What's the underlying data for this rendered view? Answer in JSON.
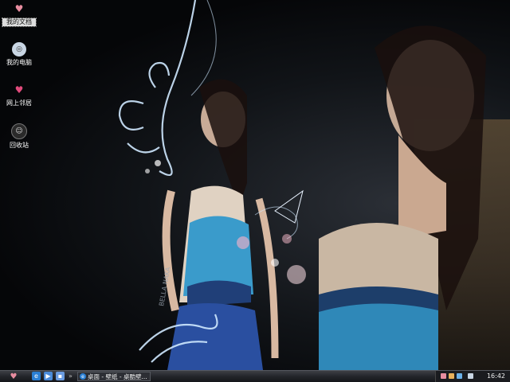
{
  "desktop": {
    "icons": [
      {
        "label": "我的文档",
        "icon": "my-documents-icon",
        "selected": true
      },
      {
        "label": "我的电脑",
        "icon": "my-computer-icon",
        "selected": false
      },
      {
        "label": "网上邻居",
        "icon": "network-places-icon",
        "selected": false
      },
      {
        "label": "回收站",
        "icon": "recycle-bin-icon",
        "selected": false
      }
    ],
    "wallpaper_text": "BELLA NAKA"
  },
  "taskbar": {
    "start_icon": "heart-icon",
    "quick_launch": [
      "internet-explorer-icon",
      "media-player-icon",
      "show-desktop-icon"
    ],
    "overflow_glyph": "»",
    "tasks": [
      {
        "label": "桌面 - 壁纸 - 桌酷壁...",
        "icon": "internet-explorer-icon"
      }
    ],
    "clock": "16:42"
  },
  "colors": {
    "taskbar": "#23252a",
    "accent_pink": "#e88da0",
    "wallpaper_swirl": "#cfe8ff",
    "dress_blue": "#2f88b8"
  }
}
